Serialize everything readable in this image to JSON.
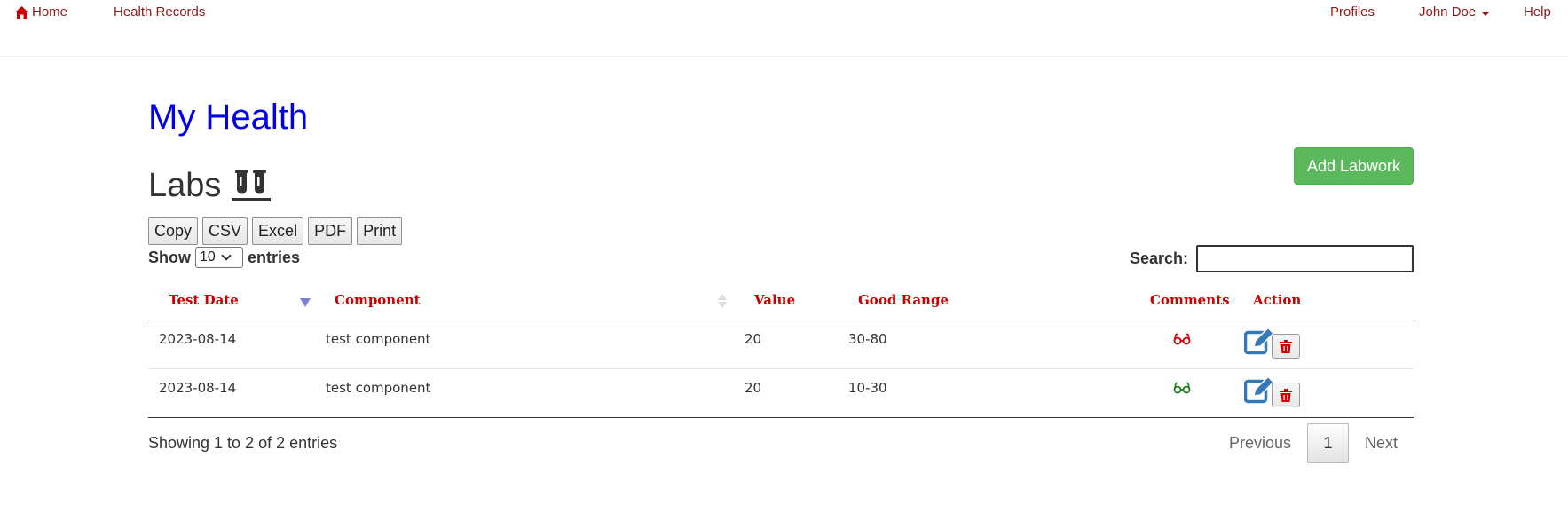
{
  "nav": {
    "home": "Home",
    "health_records": "Health Records",
    "profiles": "Profiles",
    "user": "John Doe",
    "help": "Help"
  },
  "page_title": "My Health",
  "section": {
    "title": "Labs",
    "icon": "test-tubes-icon"
  },
  "add_button": "Add Labwork",
  "export_buttons": [
    "Copy",
    "CSV",
    "Excel",
    "PDF",
    "Print"
  ],
  "length": {
    "prefix": "Show",
    "value": "10",
    "suffix": "entries"
  },
  "search": {
    "label": "Search:",
    "value": ""
  },
  "table": {
    "columns": [
      "Test Date",
      "Component",
      "Value",
      "Good Range",
      "Comments",
      "Action"
    ],
    "rows": [
      {
        "test_date": "2023-08-14",
        "component": "test component",
        "value": "20",
        "good_range": "30-80",
        "comment_icon": "glasses-icon",
        "comment_color": "#cc0000"
      },
      {
        "test_date": "2023-08-14",
        "component": "test component",
        "value": "20",
        "good_range": "10-30",
        "comment_icon": "glasses-icon",
        "comment_color": "#1a7f1a"
      }
    ]
  },
  "info": "Showing 1 to 2 of 2 entries",
  "pagination": {
    "previous": "Previous",
    "current": "1",
    "next": "Next"
  },
  "colors": {
    "nav_text": "#8b1a1a",
    "title": "#0000ee",
    "header_text": "#cc0000",
    "add_button": "#5cb85c",
    "edit_icon": "#337ab7"
  }
}
